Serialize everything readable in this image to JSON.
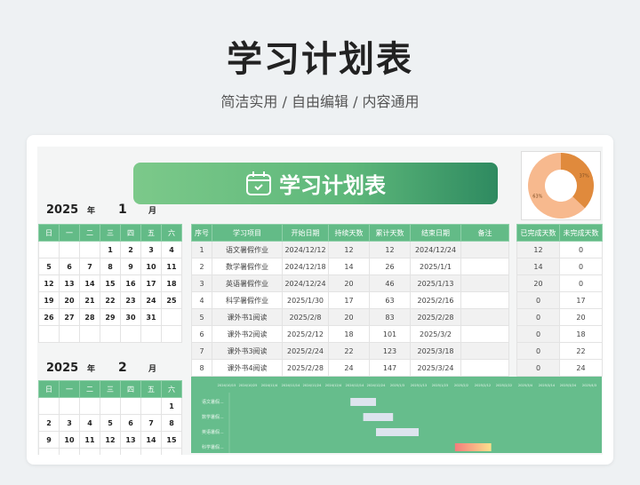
{
  "header": {
    "title": "学习计划表",
    "subtitle": "简洁实用 / 自由编辑 / 内容通用"
  },
  "banner": {
    "title": "学习计划表",
    "icon": "calendar-check-icon"
  },
  "calendars": [
    {
      "year": "2025",
      "year_unit": "年",
      "month": "1",
      "month_unit": "月",
      "weekdays": [
        "日",
        "一",
        "二",
        "三",
        "四",
        "五",
        "六"
      ],
      "weeks": [
        [
          "",
          "",
          "",
          "1",
          "2",
          "3",
          "4"
        ],
        [
          "5",
          "6",
          "7",
          "8",
          "9",
          "10",
          "11"
        ],
        [
          "12",
          "13",
          "14",
          "15",
          "16",
          "17",
          "18"
        ],
        [
          "19",
          "20",
          "21",
          "22",
          "23",
          "24",
          "25"
        ],
        [
          "26",
          "27",
          "28",
          "29",
          "30",
          "31",
          ""
        ],
        [
          "",
          "",
          "",
          "",
          "",
          "",
          ""
        ]
      ]
    },
    {
      "year": "2025",
      "year_unit": "年",
      "month": "2",
      "month_unit": "月",
      "weekdays": [
        "日",
        "一",
        "二",
        "三",
        "四",
        "五",
        "六"
      ],
      "weeks": [
        [
          "",
          "",
          "",
          "",
          "",
          "",
          "1"
        ],
        [
          "2",
          "3",
          "4",
          "5",
          "6",
          "7",
          "8"
        ],
        [
          "9",
          "10",
          "11",
          "12",
          "13",
          "14",
          "15"
        ],
        [
          "",
          "",
          "",
          "",
          "",
          "",
          ""
        ]
      ]
    }
  ],
  "table": {
    "columns": [
      "序号",
      "学习项目",
      "开始日期",
      "持续天数",
      "累计天数",
      "结束日期",
      "备注"
    ],
    "rows": [
      [
        "1",
        "语文暑假作业",
        "2024/12/12",
        "12",
        "12",
        "2024/12/24",
        ""
      ],
      [
        "2",
        "数学暑假作业",
        "2024/12/18",
        "14",
        "26",
        "2025/1/1",
        ""
      ],
      [
        "3",
        "英语暑假作业",
        "2024/12/24",
        "20",
        "46",
        "2025/1/13",
        ""
      ],
      [
        "4",
        "科学暑假作业",
        "2025/1/30",
        "17",
        "63",
        "2025/2/16",
        ""
      ],
      [
        "5",
        "课外书1阅读",
        "2025/2/8",
        "20",
        "83",
        "2025/2/28",
        ""
      ],
      [
        "6",
        "课外书2阅读",
        "2025/2/12",
        "18",
        "101",
        "2025/3/2",
        ""
      ],
      [
        "7",
        "课外书3阅读",
        "2025/2/24",
        "22",
        "123",
        "2025/3/18",
        ""
      ],
      [
        "8",
        "课外书4阅读",
        "2025/2/28",
        "24",
        "147",
        "2025/3/24",
        ""
      ]
    ]
  },
  "progress": {
    "columns": [
      "已完成天数",
      "未完成天数"
    ],
    "rows": [
      [
        "12",
        "0"
      ],
      [
        "14",
        "0"
      ],
      [
        "20",
        "0"
      ],
      [
        "0",
        "17"
      ],
      [
        "0",
        "20"
      ],
      [
        "0",
        "18"
      ],
      [
        "0",
        "22"
      ],
      [
        "0",
        "24"
      ]
    ]
  },
  "pie": {
    "type": "pie",
    "slices": [
      {
        "label": "37%",
        "value": 37,
        "color": "#e08a3c"
      },
      {
        "label": "63%",
        "value": 63,
        "color": "#f7b98e"
      }
    ]
  },
  "gantt": {
    "type": "bar",
    "ticks": [
      "2024/10/15",
      "2024/10/25",
      "2024/11/4",
      "2024/11/14",
      "2024/11/24",
      "2024/12/4",
      "2024/12/14",
      "2024/12/24",
      "2025/1/3",
      "2025/1/13",
      "2025/1/23",
      "2025/2/2",
      "2025/2/12",
      "2025/2/22",
      "2025/3/4",
      "2025/3/14",
      "2025/3/24",
      "2025/4/3"
    ],
    "tasks": [
      {
        "label": "语文暑假...",
        "start": "2024/12/12",
        "days": 12
      },
      {
        "label": "数学暑假...",
        "start": "2024/12/18",
        "days": 14
      },
      {
        "label": "英语暑假...",
        "start": "2024/12/24",
        "days": 20
      },
      {
        "label": "科学暑假...",
        "start": "2025/1/30",
        "days": 17
      }
    ],
    "bar_color": "#dde4ee",
    "highlight_colors": [
      "#f47c7c",
      "#fde08c"
    ]
  }
}
